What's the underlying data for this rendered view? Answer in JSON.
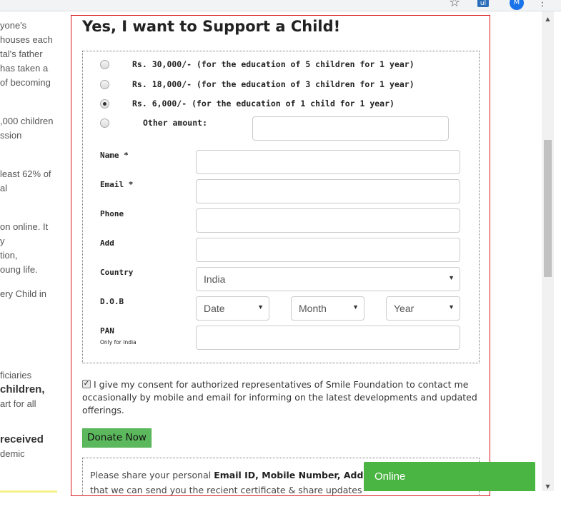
{
  "browser": {
    "star_icon": "star-icon",
    "extension_label": "ul",
    "avatar_initial": "M",
    "menu_icon": "more-vert-icon"
  },
  "left_text": [
    "yone's",
    "houses each",
    "tal's father",
    " has taken a",
    "of becoming",
    ",000 children",
    "ssion",
    "least 62% of",
    "al",
    "on online. It",
    "y",
    "tion,",
    "oung life.",
    "ery Child in",
    "ficiaries",
    "children,",
    "art for all",
    "received",
    "demic"
  ],
  "form": {
    "title": "Yes, I want to Support a Child!",
    "options": [
      {
        "label": "Rs. 30,000/- (for the education of 5 children for 1 year)",
        "checked": false
      },
      {
        "label": "Rs. 18,000/- (for the education of 3 children for 1 year)",
        "checked": false
      },
      {
        "label": "Rs. 6,000/- (for the education of 1 child for 1 year)",
        "checked": true
      },
      {
        "label": "Other amount:",
        "checked": false
      }
    ],
    "fields": {
      "name": "Name *",
      "email": "Email *",
      "phone": "Phone",
      "add": "Add",
      "country": "Country",
      "country_value": "India",
      "dob": "D.O.B",
      "dob_date": "Date",
      "dob_month": "Month",
      "dob_year": "Year",
      "pan": "PAN",
      "pan_note": "Only for India"
    },
    "consent_text": "I give my consent for authorized representatives of Smile Foundation to contact me occasionally by mobile and email for informing on the latest developments and updated offerings.",
    "consent_checked": true,
    "donate_label": "Donate Now",
    "info_prefix": "Please share your personal ",
    "info_bold": "Email ID, Mobile Number, Address",
    "info_line2": "that we can send you the recient certificate & share updates"
  },
  "chat": {
    "label": "Online",
    "color": "#4bb543"
  },
  "colors": {
    "form_border": "#d9141b",
    "donate_button": "#5cb85c"
  }
}
